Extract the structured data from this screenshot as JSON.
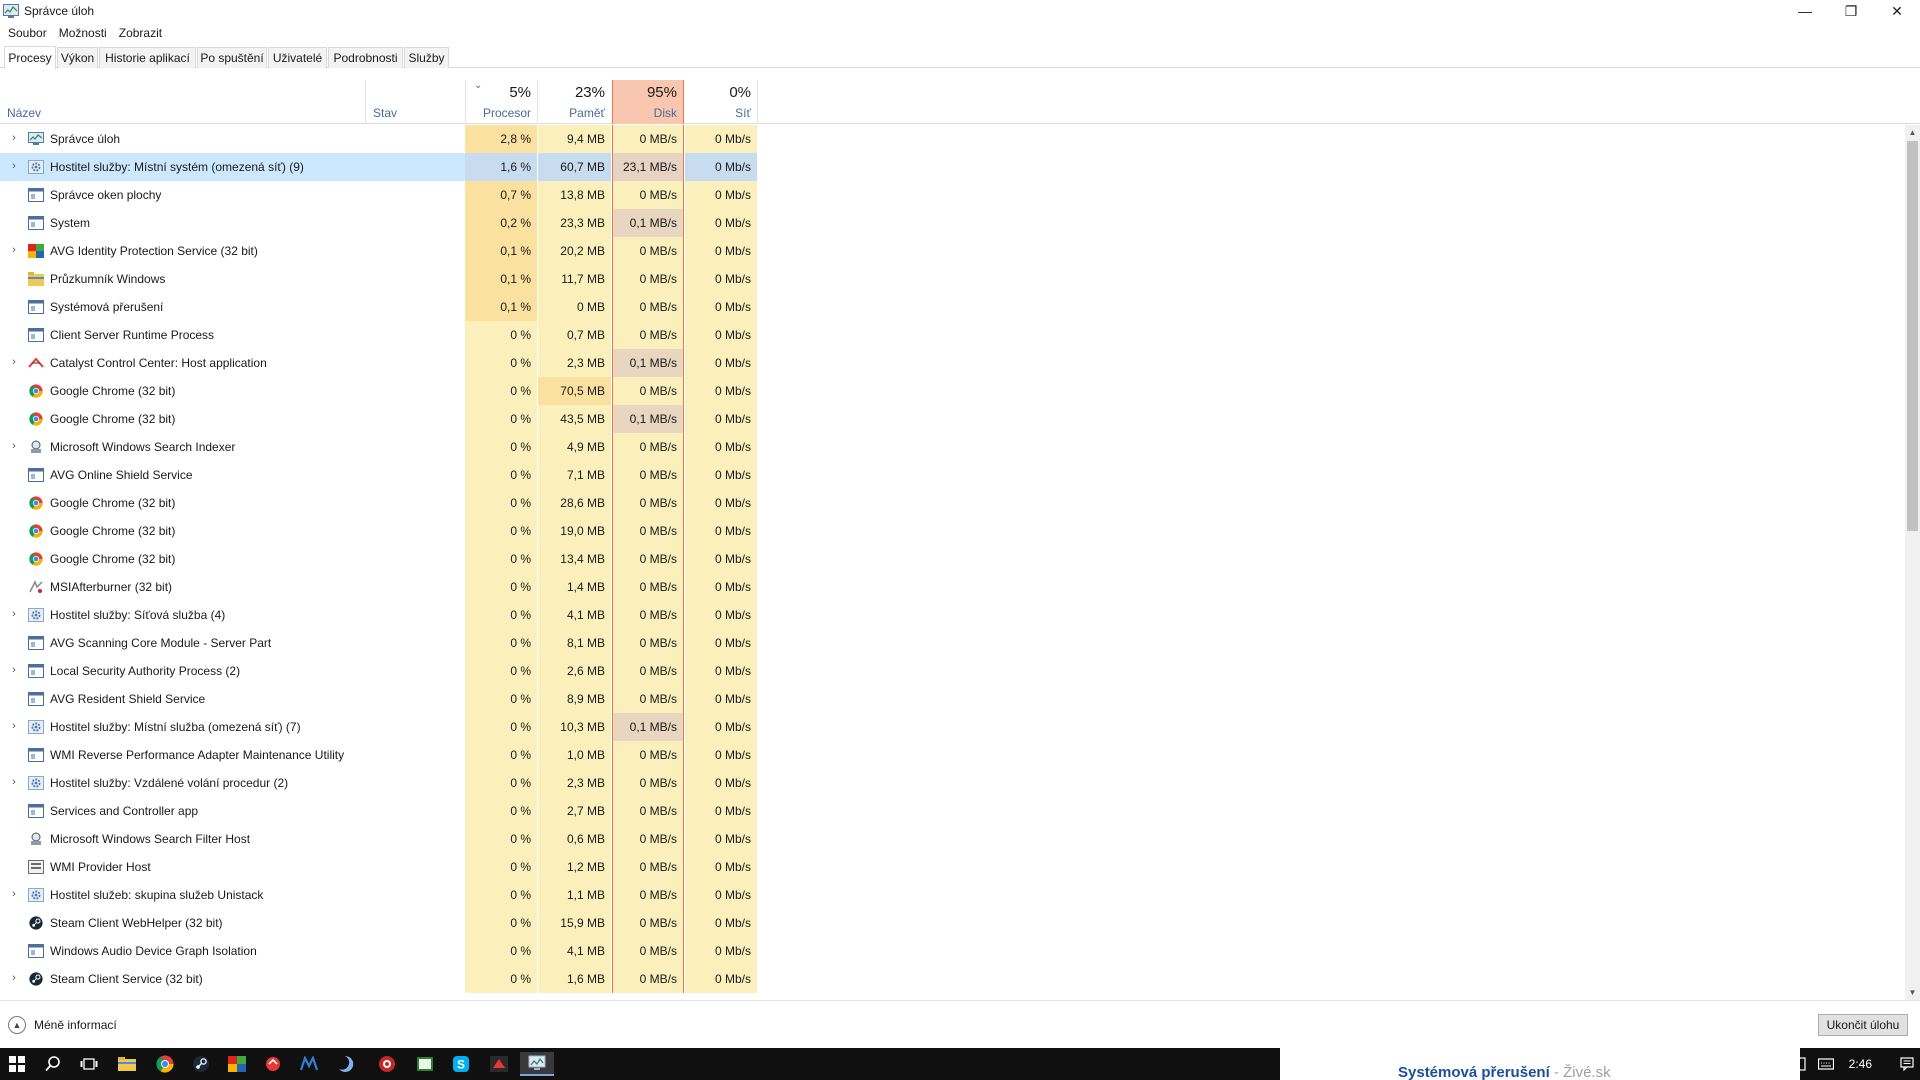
{
  "window": {
    "title": "Správce úloh",
    "controls": {
      "minimize": "—",
      "maximize": "❐",
      "close": "✕"
    }
  },
  "menu": [
    "Soubor",
    "Možnosti",
    "Zobrazit"
  ],
  "tabs": [
    "Procesy",
    "Výkon",
    "Historie aplikací",
    "Po spuštění",
    "Uživatelé",
    "Podrobnosti",
    "Služby"
  ],
  "active_tab": "Procesy",
  "columns": {
    "name": "Název",
    "status": "Stav",
    "cpu": {
      "label": "Procesor",
      "total": "5%"
    },
    "memory": {
      "label": "Paměť",
      "total": "23%"
    },
    "disk": {
      "label": "Disk",
      "total": "95%"
    },
    "network": {
      "label": "Síť",
      "total": "0%"
    }
  },
  "processes": [
    {
      "name": "Správce úloh",
      "icon": "taskmgr-icon",
      "expandable": true,
      "cpu": "2,8 %",
      "mem": "9,4 MB",
      "disk": "0 MB/s",
      "net": "0 Mb/s"
    },
    {
      "name": "Hostitel služby: Místní systém (omezená síť) (9)",
      "icon": "gear-service-icon",
      "expandable": true,
      "selected": true,
      "cpu": "1,6 %",
      "mem": "60,7 MB",
      "disk": "23,1 MB/s",
      "net": "0 Mb/s"
    },
    {
      "name": "Správce oken plochy",
      "icon": "window-app-icon",
      "expandable": false,
      "cpu": "0,7 %",
      "mem": "13,8 MB",
      "disk": "0 MB/s",
      "net": "0 Mb/s"
    },
    {
      "name": "System",
      "icon": "window-app-icon",
      "expandable": false,
      "cpu": "0,2 %",
      "mem": "23,3 MB",
      "disk": "0,1 MB/s",
      "net": "0 Mb/s"
    },
    {
      "name": "AVG Identity Protection Service (32 bit)",
      "icon": "avg-icon",
      "expandable": true,
      "cpu": "0,1 %",
      "mem": "20,2 MB",
      "disk": "0 MB/s",
      "net": "0 Mb/s"
    },
    {
      "name": "Průzkumník Windows",
      "icon": "folder-icon",
      "expandable": false,
      "cpu": "0,1 %",
      "mem": "11,7 MB",
      "disk": "0 MB/s",
      "net": "0 Mb/s"
    },
    {
      "name": "Systémová přerušení",
      "icon": "window-app-icon",
      "expandable": false,
      "cpu": "0,1 %",
      "mem": "0 MB",
      "disk": "0 MB/s",
      "net": "0 Mb/s"
    },
    {
      "name": "Client Server Runtime Process",
      "icon": "window-app-icon",
      "expandable": false,
      "cpu": "0 %",
      "mem": "0,7 MB",
      "disk": "0 MB/s",
      "net": "0 Mb/s"
    },
    {
      "name": "Catalyst Control Center: Host application",
      "icon": "amd-icon",
      "expandable": true,
      "cpu": "0 %",
      "mem": "2,3 MB",
      "disk": "0,1 MB/s",
      "net": "0 Mb/s"
    },
    {
      "name": "Google Chrome (32 bit)",
      "icon": "chrome-icon",
      "expandable": false,
      "cpu": "0 %",
      "mem": "70,5 MB",
      "disk": "0 MB/s",
      "net": "0 Mb/s"
    },
    {
      "name": "Google Chrome (32 bit)",
      "icon": "chrome-icon",
      "expandable": false,
      "cpu": "0 %",
      "mem": "43,5 MB",
      "disk": "0,1 MB/s",
      "net": "0 Mb/s"
    },
    {
      "name": "Microsoft Windows Search Indexer",
      "icon": "search-indexer-icon",
      "expandable": true,
      "cpu": "0 %",
      "mem": "4,9 MB",
      "disk": "0 MB/s",
      "net": "0 Mb/s"
    },
    {
      "name": "AVG Online Shield Service",
      "icon": "window-app-icon",
      "expandable": false,
      "cpu": "0 %",
      "mem": "7,1 MB",
      "disk": "0 MB/s",
      "net": "0 Mb/s"
    },
    {
      "name": "Google Chrome (32 bit)",
      "icon": "chrome-icon",
      "expandable": false,
      "cpu": "0 %",
      "mem": "28,6 MB",
      "disk": "0 MB/s",
      "net": "0 Mb/s"
    },
    {
      "name": "Google Chrome (32 bit)",
      "icon": "chrome-icon",
      "expandable": false,
      "cpu": "0 %",
      "mem": "19,0 MB",
      "disk": "0 MB/s",
      "net": "0 Mb/s"
    },
    {
      "name": "Google Chrome (32 bit)",
      "icon": "chrome-icon",
      "expandable": false,
      "cpu": "0 %",
      "mem": "13,4 MB",
      "disk": "0 MB/s",
      "net": "0 Mb/s"
    },
    {
      "name": "MSIAfterburner (32 bit)",
      "icon": "afterburner-icon",
      "expandable": false,
      "cpu": "0 %",
      "mem": "1,4 MB",
      "disk": "0 MB/s",
      "net": "0 Mb/s"
    },
    {
      "name": "Hostitel služby: Síťová služba (4)",
      "icon": "gear-service-icon",
      "expandable": true,
      "cpu": "0 %",
      "mem": "4,1 MB",
      "disk": "0 MB/s",
      "net": "0 Mb/s"
    },
    {
      "name": "AVG Scanning Core Module - Server Part",
      "icon": "window-app-icon",
      "expandable": false,
      "cpu": "0 %",
      "mem": "8,1 MB",
      "disk": "0 MB/s",
      "net": "0 Mb/s"
    },
    {
      "name": "Local Security Authority Process (2)",
      "icon": "window-app-icon",
      "expandable": true,
      "cpu": "0 %",
      "mem": "2,6 MB",
      "disk": "0 MB/s",
      "net": "0 Mb/s"
    },
    {
      "name": "AVG Resident Shield Service",
      "icon": "window-app-icon",
      "expandable": false,
      "cpu": "0 %",
      "mem": "8,9 MB",
      "disk": "0 MB/s",
      "net": "0 Mb/s"
    },
    {
      "name": "Hostitel služby: Místní služba (omezená síť) (7)",
      "icon": "gear-service-icon",
      "expandable": true,
      "cpu": "0 %",
      "mem": "10,3 MB",
      "disk": "0,1 MB/s",
      "net": "0 Mb/s"
    },
    {
      "name": "WMI Reverse Performance Adapter Maintenance Utility",
      "icon": "window-app-icon",
      "expandable": false,
      "cpu": "0 %",
      "mem": "1,0 MB",
      "disk": "0 MB/s",
      "net": "0 Mb/s"
    },
    {
      "name": "Hostitel služby: Vzdálené volání procedur (2)",
      "icon": "gear-service-icon",
      "expandable": true,
      "cpu": "0 %",
      "mem": "2,3 MB",
      "disk": "0 MB/s",
      "net": "0 Mb/s"
    },
    {
      "name": "Services and Controller app",
      "icon": "window-app-icon",
      "expandable": false,
      "cpu": "0 %",
      "mem": "2,7 MB",
      "disk": "0 MB/s",
      "net": "0 Mb/s"
    },
    {
      "name": "Microsoft Windows Search Filter Host",
      "icon": "search-indexer-icon",
      "expandable": false,
      "cpu": "0 %",
      "mem": "0,6 MB",
      "disk": "0 MB/s",
      "net": "0 Mb/s"
    },
    {
      "name": "WMI Provider Host",
      "icon": "wmi-icon",
      "expandable": false,
      "cpu": "0 %",
      "mem": "1,2 MB",
      "disk": "0 MB/s",
      "net": "0 Mb/s"
    },
    {
      "name": "Hostitel služeb: skupina služeb Unistack",
      "icon": "gear-service-icon",
      "expandable": true,
      "cpu": "0 %",
      "mem": "1,1 MB",
      "disk": "0 MB/s",
      "net": "0 Mb/s"
    },
    {
      "name": "Steam Client WebHelper (32 bit)",
      "icon": "steam-icon",
      "expandable": false,
      "cpu": "0 %",
      "mem": "15,9 MB",
      "disk": "0 MB/s",
      "net": "0 Mb/s"
    },
    {
      "name": "Windows Audio Device Graph Isolation",
      "icon": "window-app-icon",
      "expandable": false,
      "cpu": "0 %",
      "mem": "4,1 MB",
      "disk": "0 MB/s",
      "net": "0 Mb/s"
    },
    {
      "name": "Steam Client Service (32 bit)",
      "icon": "steam-icon",
      "expandable": true,
      "cpu": "0 %",
      "mem": "1,6 MB",
      "disk": "0 MB/s",
      "net": "0 Mb/s"
    }
  ],
  "footer": {
    "less_info": "Méně informací",
    "end_task": "Ukončit úlohu"
  },
  "taskbar": {
    "apps": [
      "start-icon",
      "search-icon",
      "task-view-icon",
      "file-explorer-icon",
      "chrome-icon",
      "steam-icon",
      "avg-icon",
      "amd-icon",
      "malwarebytes-icon",
      "app-icon",
      "afterburner-icon",
      "media-icon",
      "skype-icon",
      "catalyst-icon",
      "taskmgr-icon"
    ],
    "active_app": "taskmgr-icon",
    "clock": "2:46",
    "preview_title": "Systémová přerušení",
    "preview_suffix": " - Živé.sk"
  },
  "colors": {
    "cell_bg": "#fbefbc",
    "disk_header_bg": "#f9c6b0",
    "disk_border": "#e57b52",
    "selection": "#cce8ff",
    "header_label": "#4a6a9a"
  }
}
